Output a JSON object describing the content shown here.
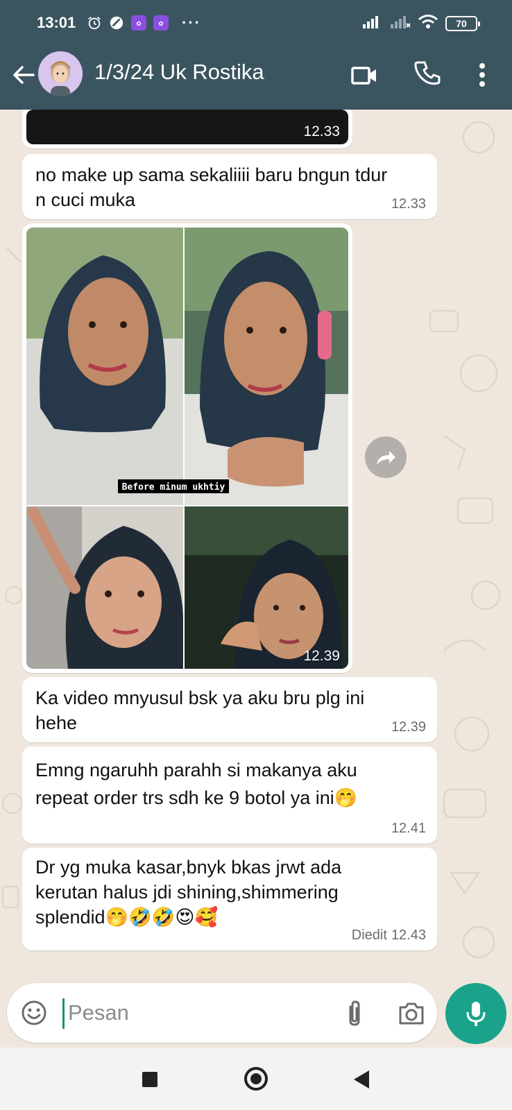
{
  "status_bar": {
    "time": "13:01",
    "more": "···",
    "battery": "70"
  },
  "header": {
    "title": "1/3/24 Uk Rostika"
  },
  "messages": [
    {
      "type": "image",
      "time": "12.33"
    },
    {
      "type": "text",
      "text": "no make up sama sekaliiii baru bngun tdur n cuci muka",
      "time": "12.33"
    },
    {
      "type": "image_collage",
      "caption": "Before minum ukhtiy",
      "time": "12.39"
    },
    {
      "type": "text",
      "text": "Ka video mnyusul bsk ya aku bru plg ini hehe",
      "time": "12.39"
    },
    {
      "type": "text",
      "text": "Emng ngaruhh parahh si makanya aku repeat order trs sdh ke 9 botol ya ini🤭",
      "time": "12.41"
    },
    {
      "type": "text",
      "text": "Dr yg muka kasar,bnyk bkas jrwt ada kerutan halus jdi shining,shimmering splendid🤭🤣🤣😍🥰",
      "edited": "Diedit",
      "time": "12.43"
    }
  ],
  "input": {
    "placeholder": "Pesan"
  },
  "colors": {
    "header_bg": "#3b5560",
    "chat_bg": "#efe7dd",
    "accent": "#1aa38a"
  },
  "icons": {
    "back": "arrow-left-icon",
    "video": "video-call-icon",
    "call": "phone-icon",
    "more": "more-vert-icon",
    "emoji": "emoji-icon",
    "attach": "paperclip-icon",
    "camera": "camera-icon",
    "mic": "mic-icon",
    "forward": "forward-icon"
  }
}
